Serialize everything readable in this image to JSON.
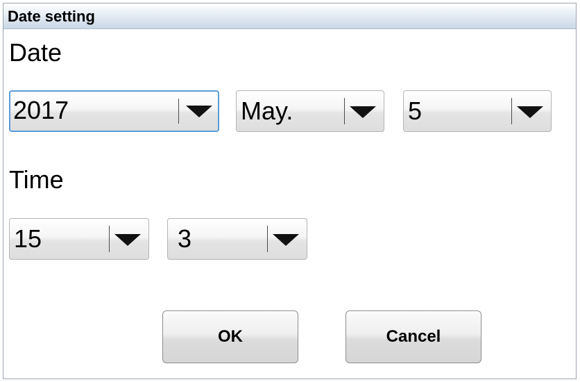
{
  "window": {
    "title": "Date setting"
  },
  "date_section": {
    "label": "Date",
    "year": {
      "value": "2017",
      "icon": "chevron-down-icon"
    },
    "month": {
      "value": "May.",
      "icon": "chevron-down-icon"
    },
    "day": {
      "value": "5",
      "icon": "chevron-down-icon"
    }
  },
  "time_section": {
    "label": "Time",
    "hour": {
      "value": "15",
      "icon": "chevron-down-icon"
    },
    "minute": {
      "value": "3",
      "icon": "chevron-down-icon"
    }
  },
  "buttons": {
    "ok": "OK",
    "cancel": "Cancel"
  },
  "colors": {
    "focus_border": "#5a9bd6",
    "titlebar_bottom": "#c9d7e6"
  }
}
